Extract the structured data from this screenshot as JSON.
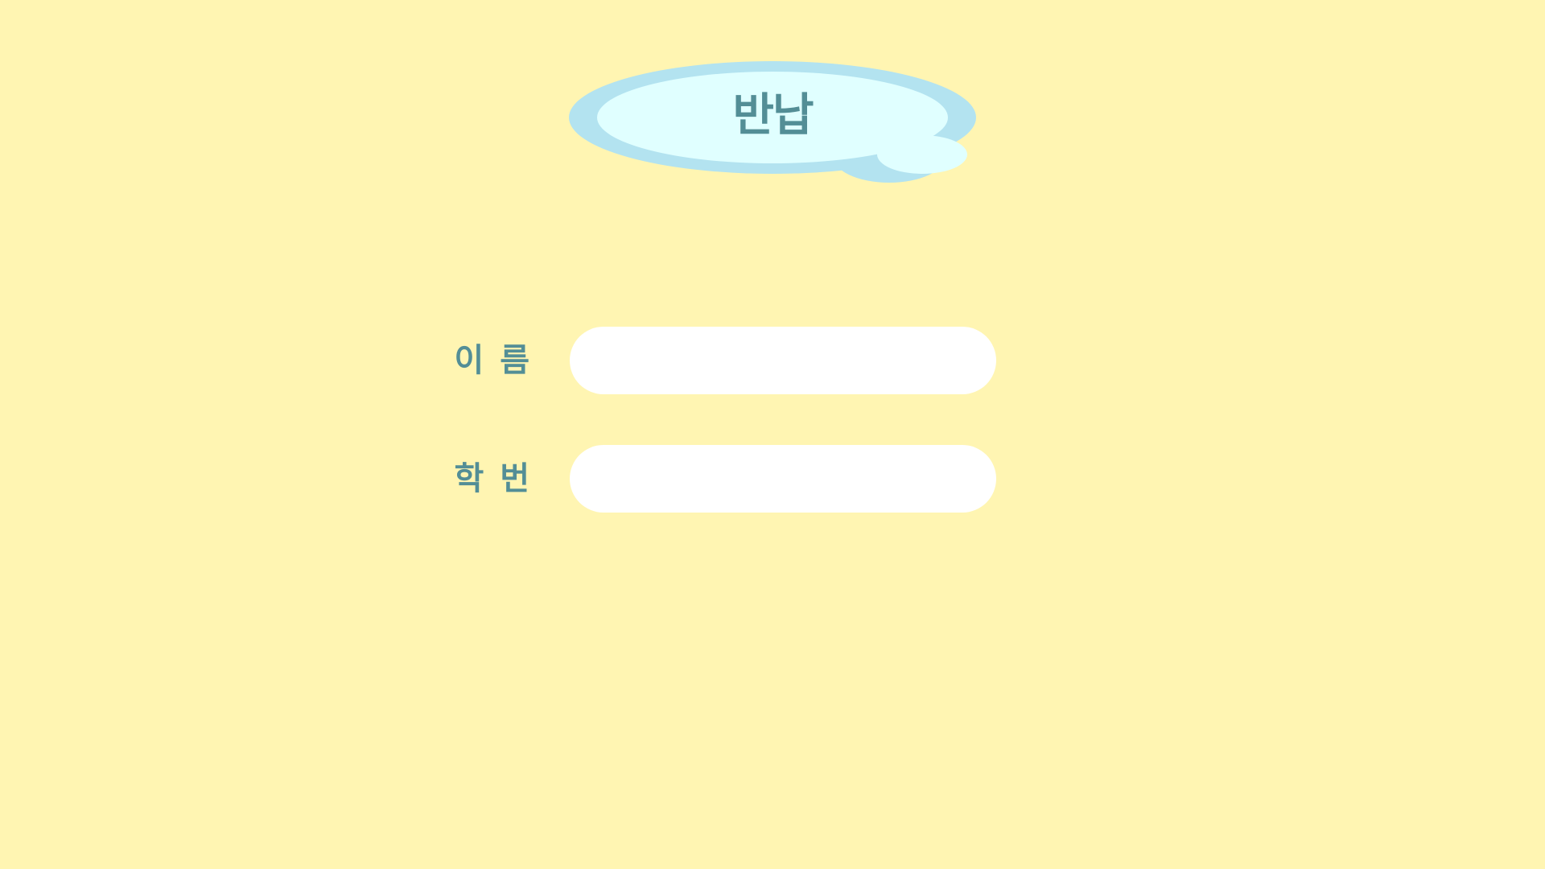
{
  "title": "반납",
  "form": {
    "name_label": "이 름",
    "name_value": "",
    "id_label": "학 번",
    "id_value": ""
  },
  "colors": {
    "background": "#fff5b2",
    "cloud_outer": "#b3e3f0",
    "cloud_inner": "#e0ffff",
    "text": "#538e96",
    "input_bg": "#ffffff"
  }
}
